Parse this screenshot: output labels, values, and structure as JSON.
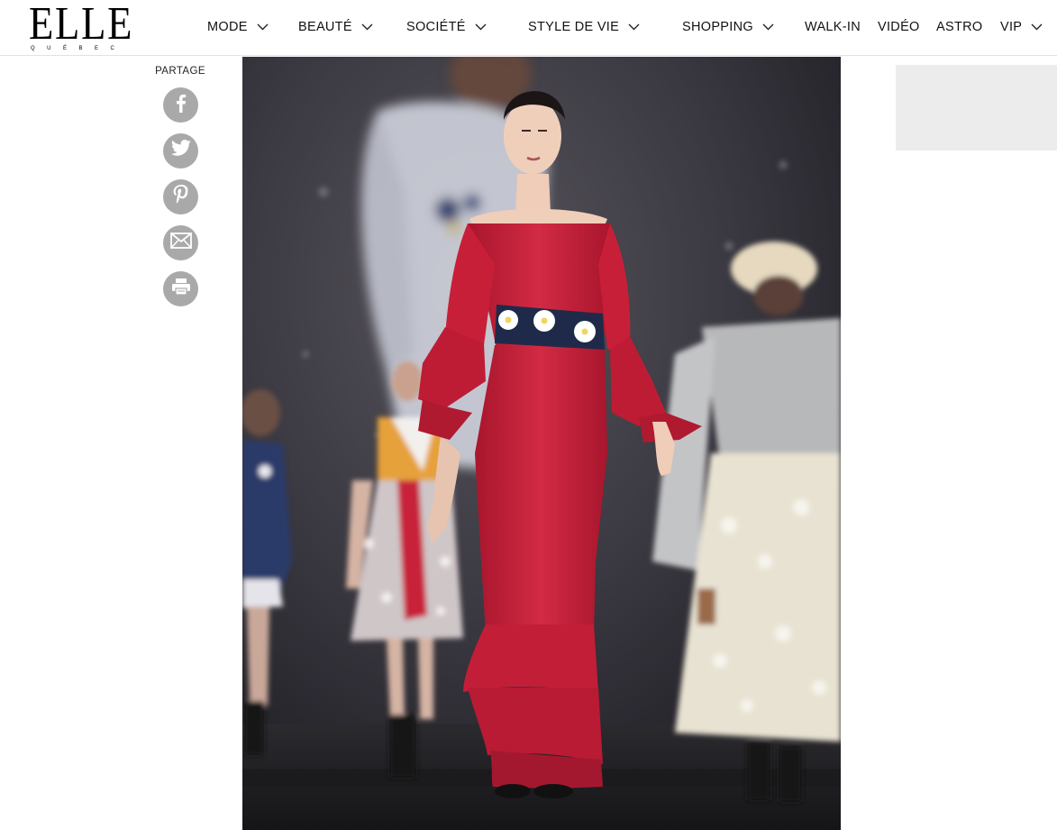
{
  "logo": {
    "main": "ELLE",
    "sub": "QUÉBEC"
  },
  "nav": {
    "items": [
      {
        "label": "MODE",
        "has_dropdown": true
      },
      {
        "label": "BEAUTÉ",
        "has_dropdown": true
      },
      {
        "label": "SOCIÉTÉ",
        "has_dropdown": true
      },
      {
        "label": "STYLE DE VIE",
        "has_dropdown": true
      },
      {
        "label": "SHOPPING",
        "has_dropdown": true
      },
      {
        "label": "WALK-IN",
        "has_dropdown": false
      },
      {
        "label": "VIDÉO",
        "has_dropdown": false
      },
      {
        "label": "ASTRO",
        "has_dropdown": false
      },
      {
        "label": "VIP",
        "has_dropdown": true
      }
    ]
  },
  "share": {
    "label": "PARTAGE",
    "buttons": [
      {
        "icon": "facebook-icon"
      },
      {
        "icon": "twitter-icon"
      },
      {
        "icon": "pinterest-icon"
      },
      {
        "icon": "email-icon"
      },
      {
        "icon": "print-icon"
      }
    ]
  },
  "hero": {
    "icon": "runway-photo"
  },
  "colors": {
    "share_button": "#a9a9a9",
    "ad_placeholder": "#ececec",
    "header_border": "#e2e2e2",
    "dress_red": "#c8213a"
  }
}
